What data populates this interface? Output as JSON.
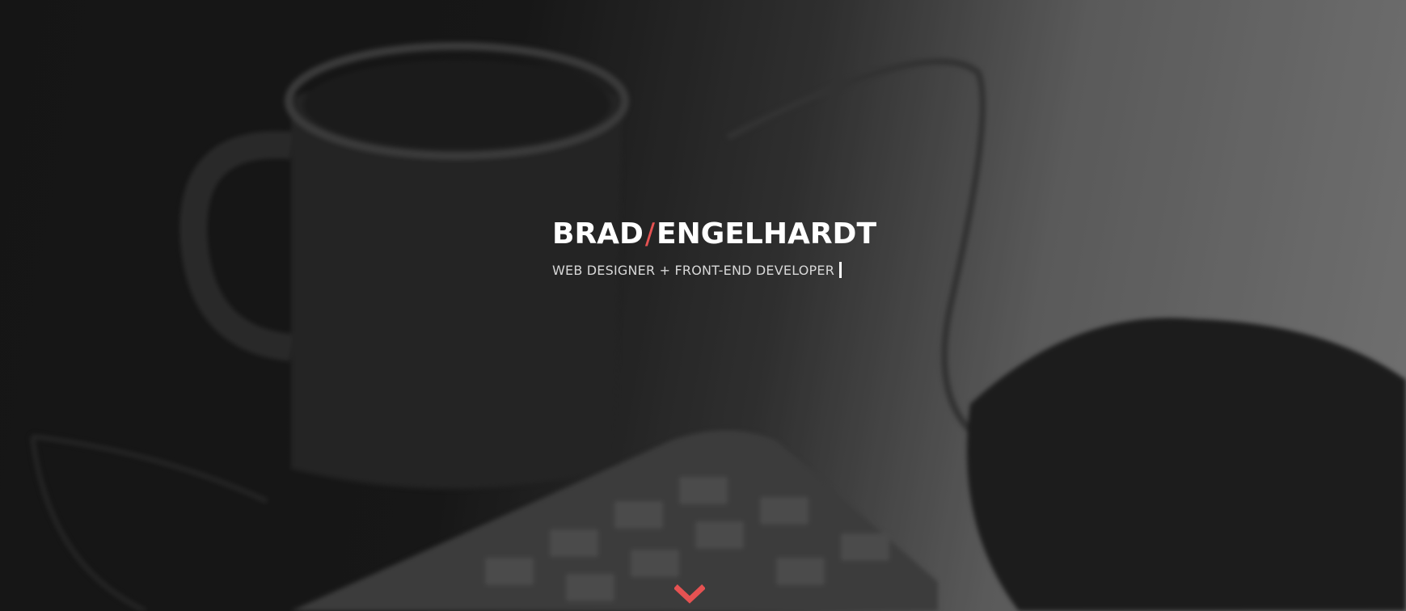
{
  "hero": {
    "first_name": "BRAD",
    "separator": "/",
    "last_name": "ENGELHARDT",
    "tagline": "WEB DESIGNER + FRONT-END DEVELOPER"
  },
  "scroll_icon": "chevron-down-icon",
  "colors": {
    "accent": "#e65252",
    "text": "#ffffff",
    "subtext": "#d8d8d8"
  }
}
